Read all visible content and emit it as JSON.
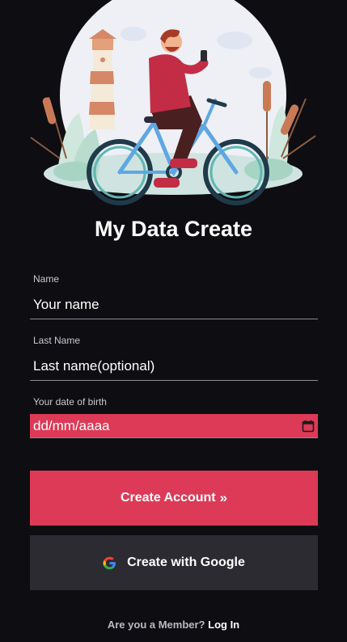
{
  "hero": {
    "image": "cyclist-illustration",
    "colors": {
      "sky": "#eef0f6",
      "jacket": "#c22d45",
      "bike": "#5fa7e3",
      "reed": "#c97a55"
    }
  },
  "page": {
    "title": "My Data Create"
  },
  "form": {
    "name_label": "Name",
    "name_placeholder": "Your name",
    "last_name_label": "Last Name",
    "last_name_placeholder": "Last name(optional)",
    "dob_label": "Your date of birth",
    "dob_placeholder": "dd/mm/aaaa",
    "dob_icon": "calendar-icon"
  },
  "actions": {
    "create_account_label": "Create Account",
    "create_account_icon": "double-chevron-right-icon",
    "google_label": "Create with Google",
    "google_icon": "google-icon"
  },
  "footer": {
    "prompt": "Are you a Member?",
    "login_label": "Log In"
  },
  "theme": {
    "background": "#0d0d12",
    "accent": "#dc3a56",
    "secondary_button": "#2b2b31"
  }
}
